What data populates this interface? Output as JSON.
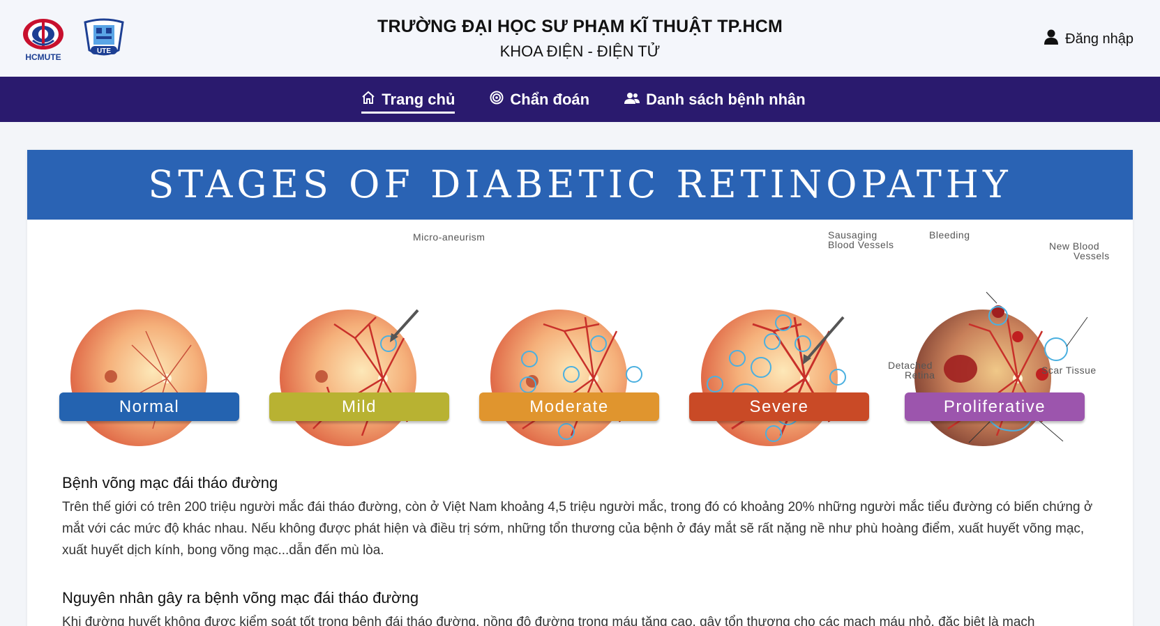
{
  "header": {
    "logo_left_text": "HCMUTE",
    "logo_right_text": "UTE",
    "university": "TRƯỜNG ĐẠI HỌC SƯ PHẠM KĨ THUẬT TP.HCM",
    "faculty": "KHOA ĐIỆN - ĐIỆN TỬ",
    "login_label": "Đăng nhập",
    "login_icon": "user-icon"
  },
  "nav": {
    "items": [
      {
        "label": "Trang chủ",
        "icon": "home-icon",
        "active": true
      },
      {
        "label": "Chẩn đoán",
        "icon": "target-icon",
        "active": false
      },
      {
        "label": "Danh sách bệnh nhân",
        "icon": "users-icon",
        "active": false
      }
    ],
    "background": "#2a1a6e"
  },
  "banner": {
    "title": "STAGES OF DIABETIC RETINOPATHY",
    "background": "#2a63b4"
  },
  "stages": [
    {
      "label": "Normal",
      "color": "#2463b0"
    },
    {
      "label": "Mild",
      "color": "#b8b232"
    },
    {
      "label": "Moderate",
      "color": "#e0952e"
    },
    {
      "label": "Severe",
      "color": "#c94a26"
    },
    {
      "label": "Proliferative",
      "color": "#9c55ad"
    }
  ],
  "annotations": {
    "micro_aneurism": "Micro-aneurism",
    "sausaging_1": "Sausaging",
    "sausaging_2": "Blood Vessels",
    "bleeding": "Bleeding",
    "new_blood_1": "New Blood",
    "new_blood_2": "Vessels",
    "detached_1": "Detached",
    "detached_2": "Retina",
    "scar_tissue": "Scar Tissue"
  },
  "sections": [
    {
      "heading": "Bệnh võng mạc đái tháo đường",
      "body": "Trên thế giới có trên 200 triệu người mắc đái tháo đường, còn ở Việt Nam khoảng 4,5 triệu người mắc, trong đó có khoảng 20% những người mắc tiểu đường có biến chứng ở mắt với các mức độ khác nhau. Nếu không được phát hiện và điều trị sớm, những tổn thương của bệnh ở đáy mắt sẽ rất nặng nề như phù hoàng điểm, xuất huyết võng mạc, xuất huyết dịch kính, bong võng mạc...dẫn đến mù lòa."
    },
    {
      "heading": "Nguyên nhân gây ra bệnh võng mạc đái tháo đường",
      "body": "Khi đường huyết không được kiểm soát tốt trong bệnh đái tháo đường, nồng độ đường trong máu tăng cao, gây tổn thương cho các mạch máu nhỏ, đặc biệt là mạch"
    }
  ]
}
